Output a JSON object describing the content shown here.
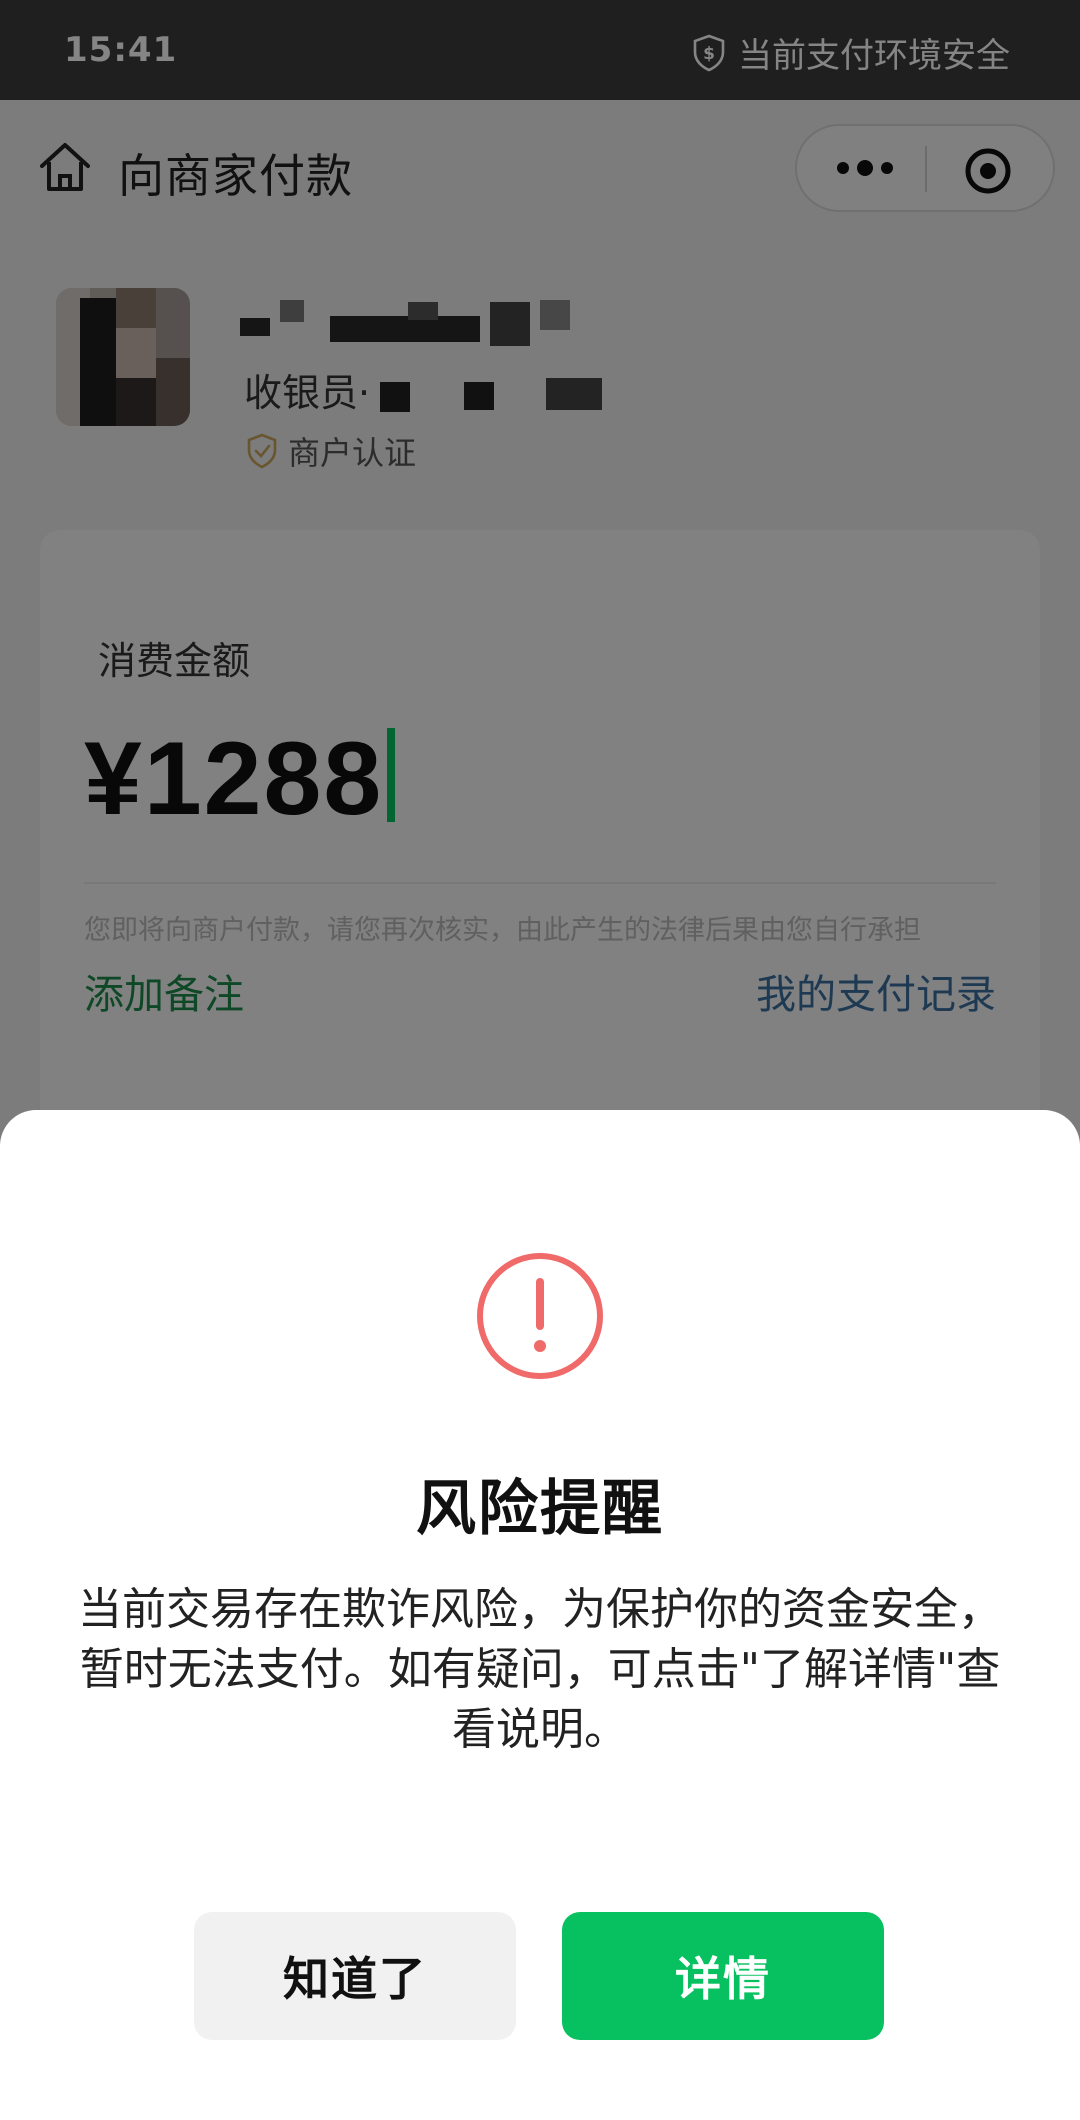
{
  "status_bar": {
    "time": "15:41",
    "security_text": "当前支付环境安全",
    "security_icon": "shield-dollar-icon"
  },
  "navbar": {
    "title": "向商家付款",
    "home_icon": "home-icon",
    "more_icon": "more-dots-icon",
    "close_icon": "target-circle-icon"
  },
  "merchant": {
    "cashier_prefix": "收银员·",
    "certified_label": "商户认证",
    "cert_icon": "shield-check-icon"
  },
  "payment": {
    "amount_label": "消费金额",
    "amount_value": "¥1288",
    "legal_notice": "您即将向商户付款，请您再次核实，由此产生的法律后果由您自行承担",
    "add_note": "添加备注",
    "records_link": "我的支付记录"
  },
  "risk_dialog": {
    "icon": "exclamation-circle-icon",
    "title": "风险提醒",
    "message": "当前交易存在欺诈风险，为保护你的资金安全，暂时无法支付。如有疑问，可点击\"了解详情\"查看说明。",
    "ok_button": "知道了",
    "detail_button": "详情"
  },
  "colors": {
    "accent_green": "#07c160",
    "warning_red": "#f06a6a",
    "link_blue": "#3a6e9e",
    "status_bar_bg": "#3d3d3d"
  }
}
